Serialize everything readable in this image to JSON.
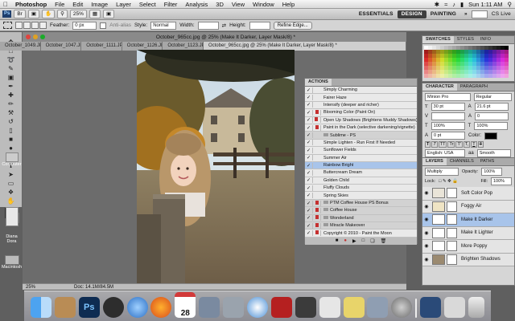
{
  "menubar": {
    "app": "Photoshop",
    "items": [
      "File",
      "Edit",
      "Image",
      "Layer",
      "Select",
      "Filter",
      "Analysis",
      "3D",
      "View",
      "Window",
      "Help"
    ],
    "clock": "Sun 1:11 AM"
  },
  "appbar": {
    "zoom": "25%",
    "workspaces": [
      "ESSENTIALS",
      "DESIGN",
      "PAINTING"
    ],
    "active_workspace": "DESIGN",
    "cs_live": "CS Live"
  },
  "options": {
    "feather_label": "Feather:",
    "feather_value": "0 px",
    "antialias": "Anti-alias",
    "style_label": "Style:",
    "style_value": "Normal",
    "width_label": "Width:",
    "height_label": "Height:",
    "refine_edge": "Refine Edge..."
  },
  "document": {
    "title": "October_965cc.jpg @ 25% (Make It Darker, Layer Mask/8) *",
    "tabs": [
      "October_1049.JPG",
      "October_1047.JPG",
      "October_1111.JPG",
      "October_1126.JPG",
      "October_1123.JPG",
      "October_965cc.jpg @ 25% (Make It Darker, Layer Mask/8) *"
    ],
    "zoom_status": "25%",
    "doc_status": "Doc: 14.1M/84.5M"
  },
  "actions": {
    "title": "ACTIONS",
    "rows": [
      {
        "label": "Simply Charming",
        "type": "action",
        "dialog": false
      },
      {
        "label": "Fairer Haze",
        "type": "action",
        "dialog": false
      },
      {
        "label": "Intensify (deeper and richer)",
        "type": "action",
        "dialog": false
      },
      {
        "label": "Blooming Color (Paint On)",
        "type": "action",
        "dialog": true
      },
      {
        "label": "Open Up Shadows (Brightens Muddy Shadows)",
        "type": "action",
        "dialog": true
      },
      {
        "label": "Paint in the Dark (selective darkening/vignette)",
        "type": "action",
        "dialog": true
      },
      {
        "label": "Sublime - PS",
        "type": "set",
        "dialog": false
      },
      {
        "label": "Simple Lighten - Run First If Needed",
        "type": "action",
        "dialog": false
      },
      {
        "label": "Sunflower Fields",
        "type": "action",
        "dialog": false
      },
      {
        "label": "Summer Air",
        "type": "action",
        "dialog": false
      },
      {
        "label": "Rainbow Bright",
        "type": "action",
        "dialog": false,
        "selected": true
      },
      {
        "label": "Buttercream Dream",
        "type": "action",
        "dialog": false
      },
      {
        "label": "Golden Child",
        "type": "action",
        "dialog": false
      },
      {
        "label": "Fluffy Clouds",
        "type": "action",
        "dialog": false
      },
      {
        "label": "Spring Skies",
        "type": "action",
        "dialog": false
      },
      {
        "label": "PTM Coffee House PS Bonus",
        "type": "set",
        "dialog": true
      },
      {
        "label": "Coffee House",
        "type": "set",
        "dialog": true
      },
      {
        "label": "Wonderland",
        "type": "set",
        "dialog": true
      },
      {
        "label": "Miracle Makeover",
        "type": "set",
        "dialog": true
      },
      {
        "label": "Copyright © 2010 - Paint the Moon",
        "type": "action",
        "dialog": true
      }
    ]
  },
  "swatches": {
    "tabs": [
      "SWATCHES",
      "STYLES",
      "INFO"
    ]
  },
  "character": {
    "tabs": [
      "CHARACTER",
      "PARAGRAPH"
    ],
    "font": "Minion Pro",
    "style": "Regular",
    "size": "30 pt",
    "leading": "21.6 pt",
    "kerning": "",
    "tracking": "0",
    "vscale": "100%",
    "hscale": "100%",
    "baseline": "0 pt",
    "color_label": "Color:",
    "language": "English: USA",
    "aa_label": "aa",
    "aa_value": "Smooth"
  },
  "layers": {
    "tabs": [
      "LAYERS",
      "CHANNELS",
      "PATHS"
    ],
    "blend": "Multiply",
    "opacity_label": "Opacity:",
    "opacity": "100%",
    "lock_label": "Lock:",
    "fill_label": "Fill:",
    "fill": "100%",
    "rows": [
      {
        "name": "Soft Color Pop",
        "selected": false
      },
      {
        "name": "Foggy Air",
        "selected": false
      },
      {
        "name": "Make It Darker",
        "selected": true
      },
      {
        "name": "Make It Lighter",
        "selected": false
      },
      {
        "name": "More Poppy",
        "selected": false
      },
      {
        "name": "Brighten Shadows",
        "selected": false
      }
    ]
  },
  "desktop": {
    "icons": [
      "Computer",
      "Diana",
      "Dora",
      "Macintosh"
    ]
  },
  "dock": {
    "calendar_day": "28"
  }
}
